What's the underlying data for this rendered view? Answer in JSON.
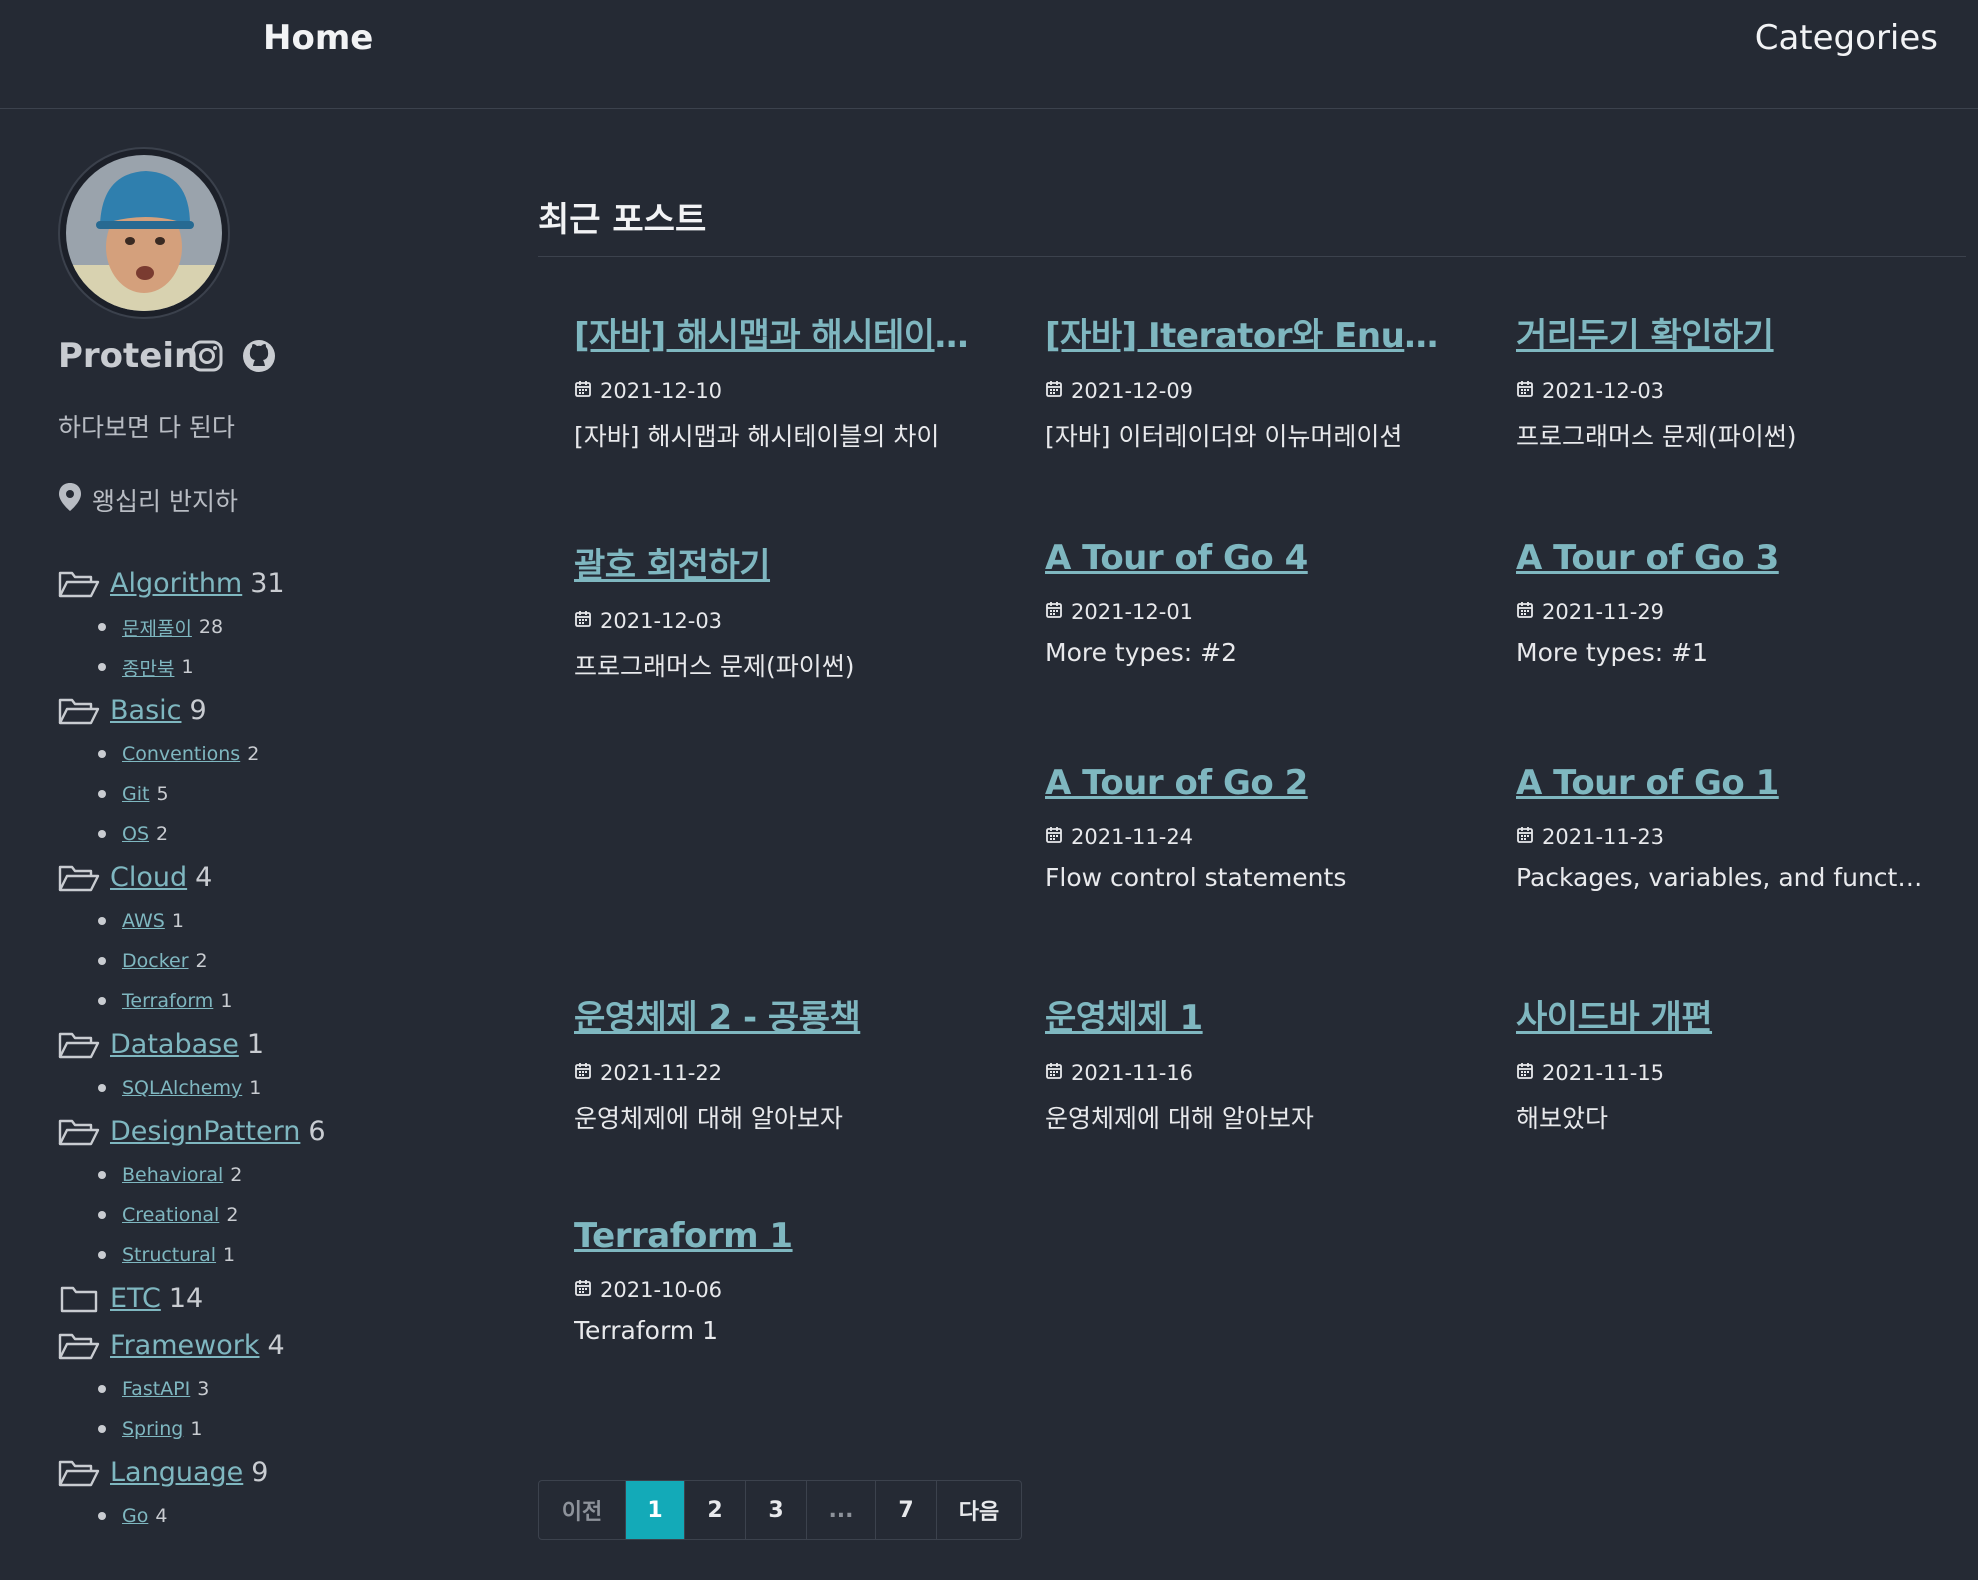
{
  "nav": {
    "home": "Home",
    "categories": "Categories"
  },
  "profile": {
    "name": "Protein",
    "motto": "하다보면 다 된다",
    "location": "왱십리 반지하"
  },
  "categories": [
    {
      "name": "Algorithm",
      "count": "31",
      "subs": [
        {
          "name": "문제풀이",
          "count": "28"
        },
        {
          "name": "종만북",
          "count": "1"
        }
      ]
    },
    {
      "name": "Basic",
      "count": "9",
      "subs": [
        {
          "name": "Conventions",
          "count": "2"
        },
        {
          "name": "Git",
          "count": "5"
        },
        {
          "name": "OS",
          "count": "2"
        }
      ]
    },
    {
      "name": "Cloud",
      "count": "4",
      "subs": [
        {
          "name": "AWS",
          "count": "1"
        },
        {
          "name": "Docker",
          "count": "2"
        },
        {
          "name": "Terraform",
          "count": "1"
        }
      ]
    },
    {
      "name": "Database",
      "count": "1",
      "subs": [
        {
          "name": "SQLAlchemy",
          "count": "1"
        }
      ]
    },
    {
      "name": "DesignPattern",
      "count": "6",
      "subs": [
        {
          "name": "Behavioral",
          "count": "2"
        },
        {
          "name": "Creational",
          "count": "2"
        },
        {
          "name": "Structural",
          "count": "1"
        }
      ]
    },
    {
      "name": "ETC",
      "count": "14",
      "subs": []
    },
    {
      "name": "Framework",
      "count": "4",
      "subs": [
        {
          "name": "FastAPI",
          "count": "3"
        },
        {
          "name": "Spring",
          "count": "1"
        }
      ]
    },
    {
      "name": "Language",
      "count": "9",
      "subs": [
        {
          "name": "Go",
          "count": "4"
        }
      ]
    }
  ],
  "section_title": "최근 포스트",
  "posts": [
    {
      "title": "[자바] 해시맵과 해시테이블의 차이",
      "date": "2021-12-10",
      "desc": "[자바] 해시맵과 해시테이블의 차이"
    },
    {
      "title": "[자바] Iterator와 Enumeration",
      "date": "2021-12-09",
      "desc": "[자바] 이터레이더와 이뉴머레이션"
    },
    {
      "title": "거리두기 확인하기",
      "date": "2021-12-03",
      "desc": "프로그래머스 문제(파이썬)"
    },
    {
      "title": "괄호 회전하기",
      "date": "2021-12-03",
      "desc": "프로그래머스 문제(파이썬)"
    },
    {
      "title": "A Tour of Go 4",
      "date": "2021-12-01",
      "desc": "More types: #2"
    },
    {
      "title": "A Tour of Go 3",
      "date": "2021-11-29",
      "desc": "More types: #1"
    },
    {
      "title": "A Tour of Go 2",
      "date": "2021-11-24",
      "desc": "Flow control statements"
    },
    {
      "title": "A Tour of Go 1",
      "date": "2021-11-23",
      "desc": "Packages, variables, and functions"
    },
    {
      "title": "운영체제 2 - 공룡책",
      "date": "2021-11-22",
      "desc": "운영체제에 대해 알아보자"
    },
    {
      "title": "운영체제 1",
      "date": "2021-11-16",
      "desc": "운영체제에 대해 알아보자"
    },
    {
      "title": "사이드바 개편",
      "date": "2021-11-15",
      "desc": "해보았다"
    },
    {
      "title": "Terraform 1",
      "date": "2021-10-06",
      "desc": "Terraform 1"
    }
  ],
  "pagination": {
    "prev": "이전",
    "pages": [
      "1",
      "2",
      "3",
      "...",
      "7"
    ],
    "current": "1",
    "next": "다음"
  },
  "colors": {
    "background": "#252a34",
    "link": "#7fb7c0",
    "active_page": "#13aab8"
  },
  "icons": {
    "instagram": "instagram-icon",
    "github": "github-icon",
    "location": "map-pin-icon",
    "folder": "folder-icon",
    "date": "calendar-icon"
  }
}
